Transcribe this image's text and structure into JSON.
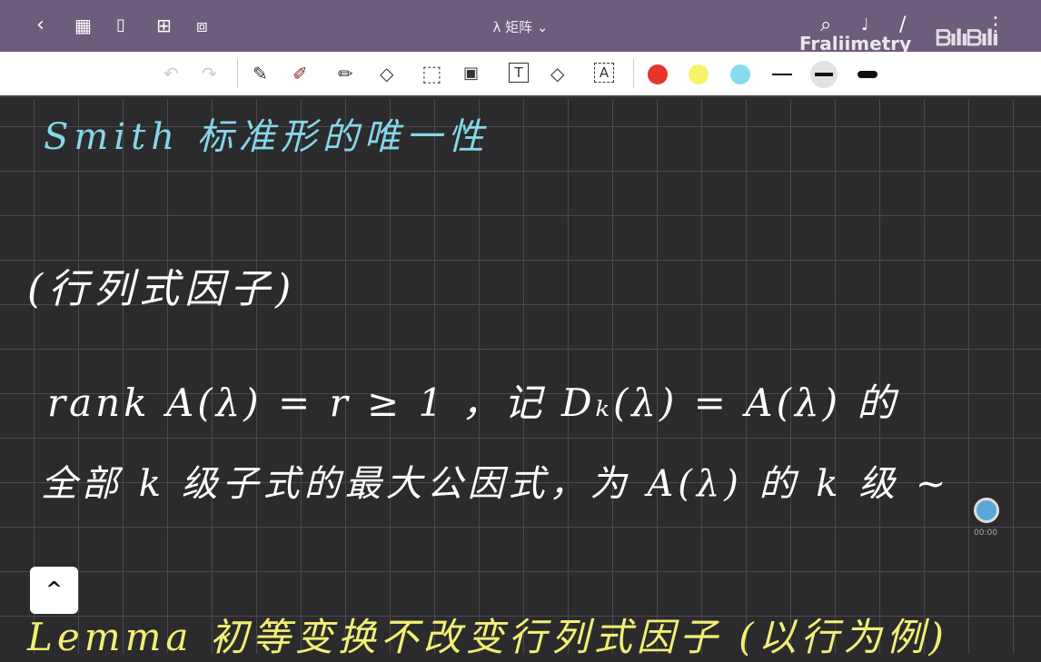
{
  "topbar": {
    "title": "λ 矩阵",
    "title_chevron": "⌄",
    "watermark": "Fraliimetry",
    "logo": "bilibili",
    "icons": {
      "back": "‹",
      "grid": "▦",
      "bookmark": "🔖",
      "add_page": "⊞",
      "crop": "⧈",
      "search": "⌕",
      "mic": "🎙",
      "pen": "/",
      "more": "⋮"
    }
  },
  "toolbar": {
    "undo": "↶",
    "redo": "↷",
    "pen": "✎",
    "highlighter": "✐",
    "eraser": "⌫",
    "lasso": "⬚",
    "image": "🖼",
    "text": "T",
    "shape": "◇",
    "ocr": "A",
    "colors": [
      "#e8352b",
      "#f6f36a",
      "#86dcef"
    ],
    "widths": [
      "thin",
      "medium",
      "thick"
    ]
  },
  "notes": {
    "title": "Smith 标准形的唯一性",
    "heading": "(行列式因子)",
    "line1": "rank A(λ) = r ≥ 1 ，记 Dₖ(λ) = A(λ) 的",
    "line2": "全部 k 级子式的最大公因式，为 A(λ) 的 k 级 ~",
    "lemma": "Lemma  初等变换不改变行列式因子 (以行为例)"
  },
  "recorder": {
    "time": "00:00"
  },
  "scroll_up": "^"
}
